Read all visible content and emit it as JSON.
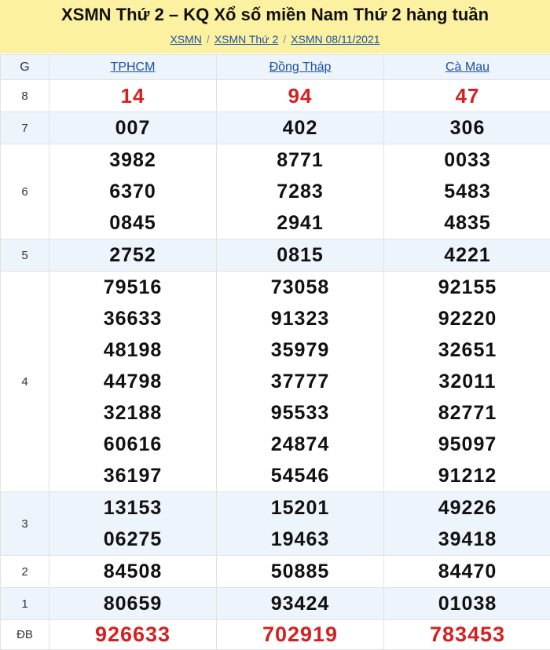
{
  "header": {
    "title": "XSMN Thứ 2 – KQ Xổ số miền Nam Thứ 2 hàng tuần",
    "breadcrumb": [
      "XSMN",
      "XSMN Thứ 2",
      "XSMN 08/11/2021"
    ],
    "separator": "/"
  },
  "table": {
    "col_prize": "G",
    "provinces": [
      "TPHCM",
      "Đồng Tháp",
      "Cà Mau"
    ],
    "rows": {
      "g8": {
        "label": "8",
        "values": [
          [
            "14"
          ],
          [
            "94"
          ],
          [
            "47"
          ]
        ]
      },
      "g7": {
        "label": "7",
        "values": [
          [
            "007"
          ],
          [
            "402"
          ],
          [
            "306"
          ]
        ]
      },
      "g6": {
        "label": "6",
        "values": [
          [
            "3982",
            "6370",
            "0845"
          ],
          [
            "8771",
            "7283",
            "2941"
          ],
          [
            "0033",
            "5483",
            "4835"
          ]
        ]
      },
      "g5": {
        "label": "5",
        "values": [
          [
            "2752"
          ],
          [
            "0815"
          ],
          [
            "4221"
          ]
        ]
      },
      "g4": {
        "label": "4",
        "values": [
          [
            "79516",
            "36633",
            "48198",
            "44798",
            "32188",
            "60616",
            "36197"
          ],
          [
            "73058",
            "91323",
            "35979",
            "37777",
            "95533",
            "24874",
            "54546"
          ],
          [
            "92155",
            "92220",
            "32651",
            "32011",
            "82771",
            "95097",
            "91212"
          ]
        ]
      },
      "g3": {
        "label": "3",
        "values": [
          [
            "13153",
            "06275"
          ],
          [
            "15201",
            "19463"
          ],
          [
            "49226",
            "39418"
          ]
        ]
      },
      "g2": {
        "label": "2",
        "values": [
          [
            "84508"
          ],
          [
            "50885"
          ],
          [
            "84470"
          ]
        ]
      },
      "g1": {
        "label": "1",
        "values": [
          [
            "80659"
          ],
          [
            "93424"
          ],
          [
            "01038"
          ]
        ]
      },
      "db": {
        "label": "ĐB",
        "values": [
          [
            "926633"
          ],
          [
            "702919"
          ],
          [
            "783453"
          ]
        ]
      }
    }
  },
  "colors": {
    "header_bg": "#fcf1a0",
    "alt_row_bg": "#eef4fb",
    "special_red": "#d62020",
    "link_blue": "#1a4fa8"
  }
}
